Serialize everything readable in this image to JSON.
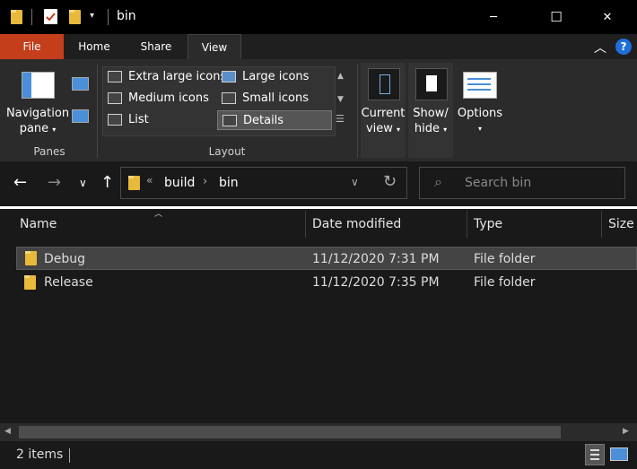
{
  "window": {
    "title": "bin",
    "controls": {
      "minimize": "─",
      "maximize": "☐",
      "close": "✕"
    }
  },
  "ribbon": {
    "tabs": [
      "File",
      "Home",
      "Share",
      "View"
    ],
    "active_tab": "View",
    "panes": {
      "navigation_pane_label_line1": "Navigation",
      "navigation_pane_label_line2": "pane",
      "group_label": "Panes"
    },
    "layout": {
      "group_label": "Layout",
      "items": [
        "Extra large icons",
        "Large icons",
        "Medium icons",
        "Small icons",
        "List",
        "Details"
      ],
      "selected": "Details"
    },
    "current_view": {
      "line1": "Current",
      "line2": "view"
    },
    "show_hide": {
      "line1": "Show/",
      "line2": "hide"
    },
    "options": {
      "label": "Options"
    }
  },
  "address": {
    "overflow": "«",
    "crumbs": [
      "build",
      "bin"
    ],
    "search_placeholder": "Search bin"
  },
  "columns": [
    "Name",
    "Date modified",
    "Type",
    "Size"
  ],
  "files": [
    {
      "name": "Debug",
      "date": "11/12/2020 7:31 PM",
      "type": "File folder",
      "selected": true
    },
    {
      "name": "Release",
      "date": "11/12/2020 7:35 PM",
      "type": "File folder",
      "selected": false
    }
  ],
  "status": {
    "item_count": "2 items"
  },
  "colors": {
    "file_tab": "#c43e1c",
    "folder": "#e8b93a",
    "background": "#191919",
    "ribbon": "#2b2b2b"
  }
}
